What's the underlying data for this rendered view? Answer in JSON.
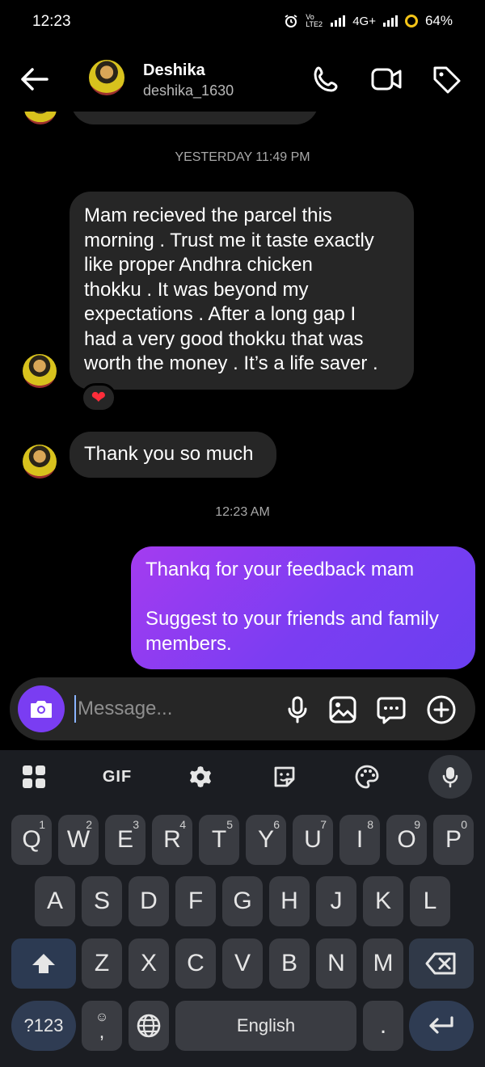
{
  "status_bar": {
    "time": "12:23",
    "network": "4G+",
    "volte": "Vo LTE2",
    "battery": "64%"
  },
  "header": {
    "name": "Deshika",
    "username": "deshika_1630"
  },
  "chat": {
    "timestamp_1": "YESTERDAY 11:49 PM",
    "message_1_lines": [
      "Mam recieved the parcel this",
      "morning . Trust me it taste exactly",
      "like proper Andhra chicken",
      "thokku . It was beyond my",
      "expectations . After a long gap I",
      "had a very good thokku that was",
      "worth the money . It’s a life saver ."
    ],
    "reaction": "❤",
    "message_2": "Thank you so much",
    "timestamp_2": "12:23 AM",
    "sent_line_1": "Thankq for your feedback mam",
    "sent_line_2": "Suggest to your friends and family",
    "sent_line_3": "members."
  },
  "composer": {
    "placeholder": "Message..."
  },
  "keyboard": {
    "toolbar_gif": "GIF",
    "row1": [
      {
        "label": "Q",
        "hint": "1"
      },
      {
        "label": "W",
        "hint": "2"
      },
      {
        "label": "E",
        "hint": "3"
      },
      {
        "label": "R",
        "hint": "4"
      },
      {
        "label": "T",
        "hint": "5"
      },
      {
        "label": "Y",
        "hint": "6"
      },
      {
        "label": "U",
        "hint": "7"
      },
      {
        "label": "I",
        "hint": "8"
      },
      {
        "label": "O",
        "hint": "9"
      },
      {
        "label": "P",
        "hint": "0"
      }
    ],
    "row2": [
      "A",
      "S",
      "D",
      "F",
      "G",
      "H",
      "J",
      "K",
      "L"
    ],
    "row3": [
      "Z",
      "X",
      "C",
      "V",
      "B",
      "N",
      "M"
    ],
    "symbols_key": "?123",
    "emoji_comma_key": ",",
    "space_label": "English",
    "period_key": "."
  }
}
